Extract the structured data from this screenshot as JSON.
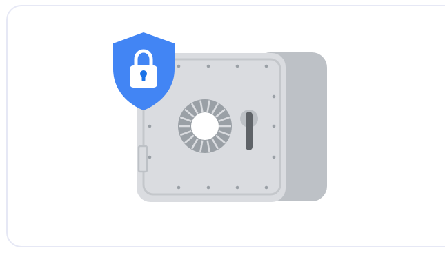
{
  "illustration": {
    "subject": "safe-vault-with-security-shield",
    "icons": [
      "shield-lock-icon",
      "safe-icon",
      "combination-dial-icon",
      "keyhole-icon"
    ],
    "colors": {
      "card_border": "#e6e8f5",
      "shield": "#4285f4",
      "lock_body": "#ffffff",
      "keyhole": "#1a73e8",
      "safe_front": "#dadce0",
      "safe_side": "#bdc1c6",
      "safe_frame": "#c4c7cb",
      "rivets": "#9aa0a6",
      "dial_outer": "#9aa0a6",
      "dial_inner": "#ffffff",
      "handle": "#5f6368"
    }
  }
}
